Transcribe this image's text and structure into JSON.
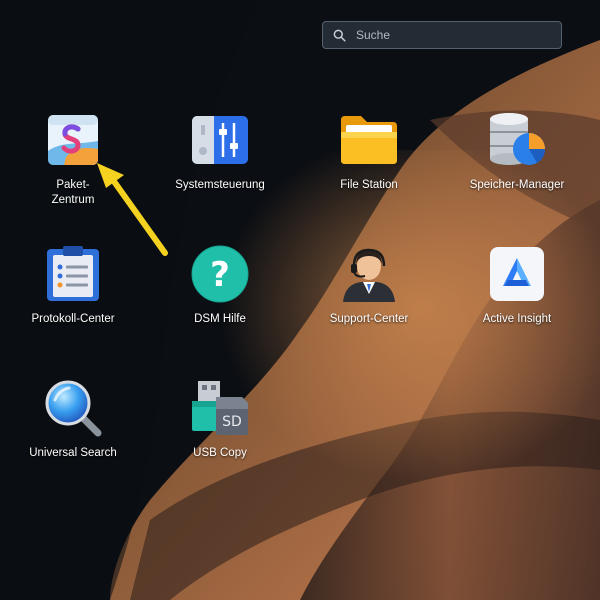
{
  "search": {
    "placeholder": "Suche"
  },
  "apps": [
    {
      "label": "Paket-\nZentrum",
      "icon": "package-center-icon"
    },
    {
      "label": "Systemsteuerung",
      "icon": "control-panel-icon"
    },
    {
      "label": "File Station",
      "icon": "folder-icon"
    },
    {
      "label": "Speicher-Manager",
      "icon": "storage-manager-icon"
    },
    {
      "label": "Protokoll-Center",
      "icon": "log-center-icon"
    },
    {
      "label": "DSM Hilfe",
      "icon": "help-icon"
    },
    {
      "label": "Support-Center",
      "icon": "support-agent-icon"
    },
    {
      "label": "Active Insight",
      "icon": "active-insight-icon"
    },
    {
      "label": "Universal Search",
      "icon": "magnifier-icon"
    },
    {
      "label": "USB Copy",
      "icon": "usb-sd-icon"
    }
  ],
  "colors": {
    "arrow": "#f5d21f",
    "accent": "#2e7cf6"
  }
}
